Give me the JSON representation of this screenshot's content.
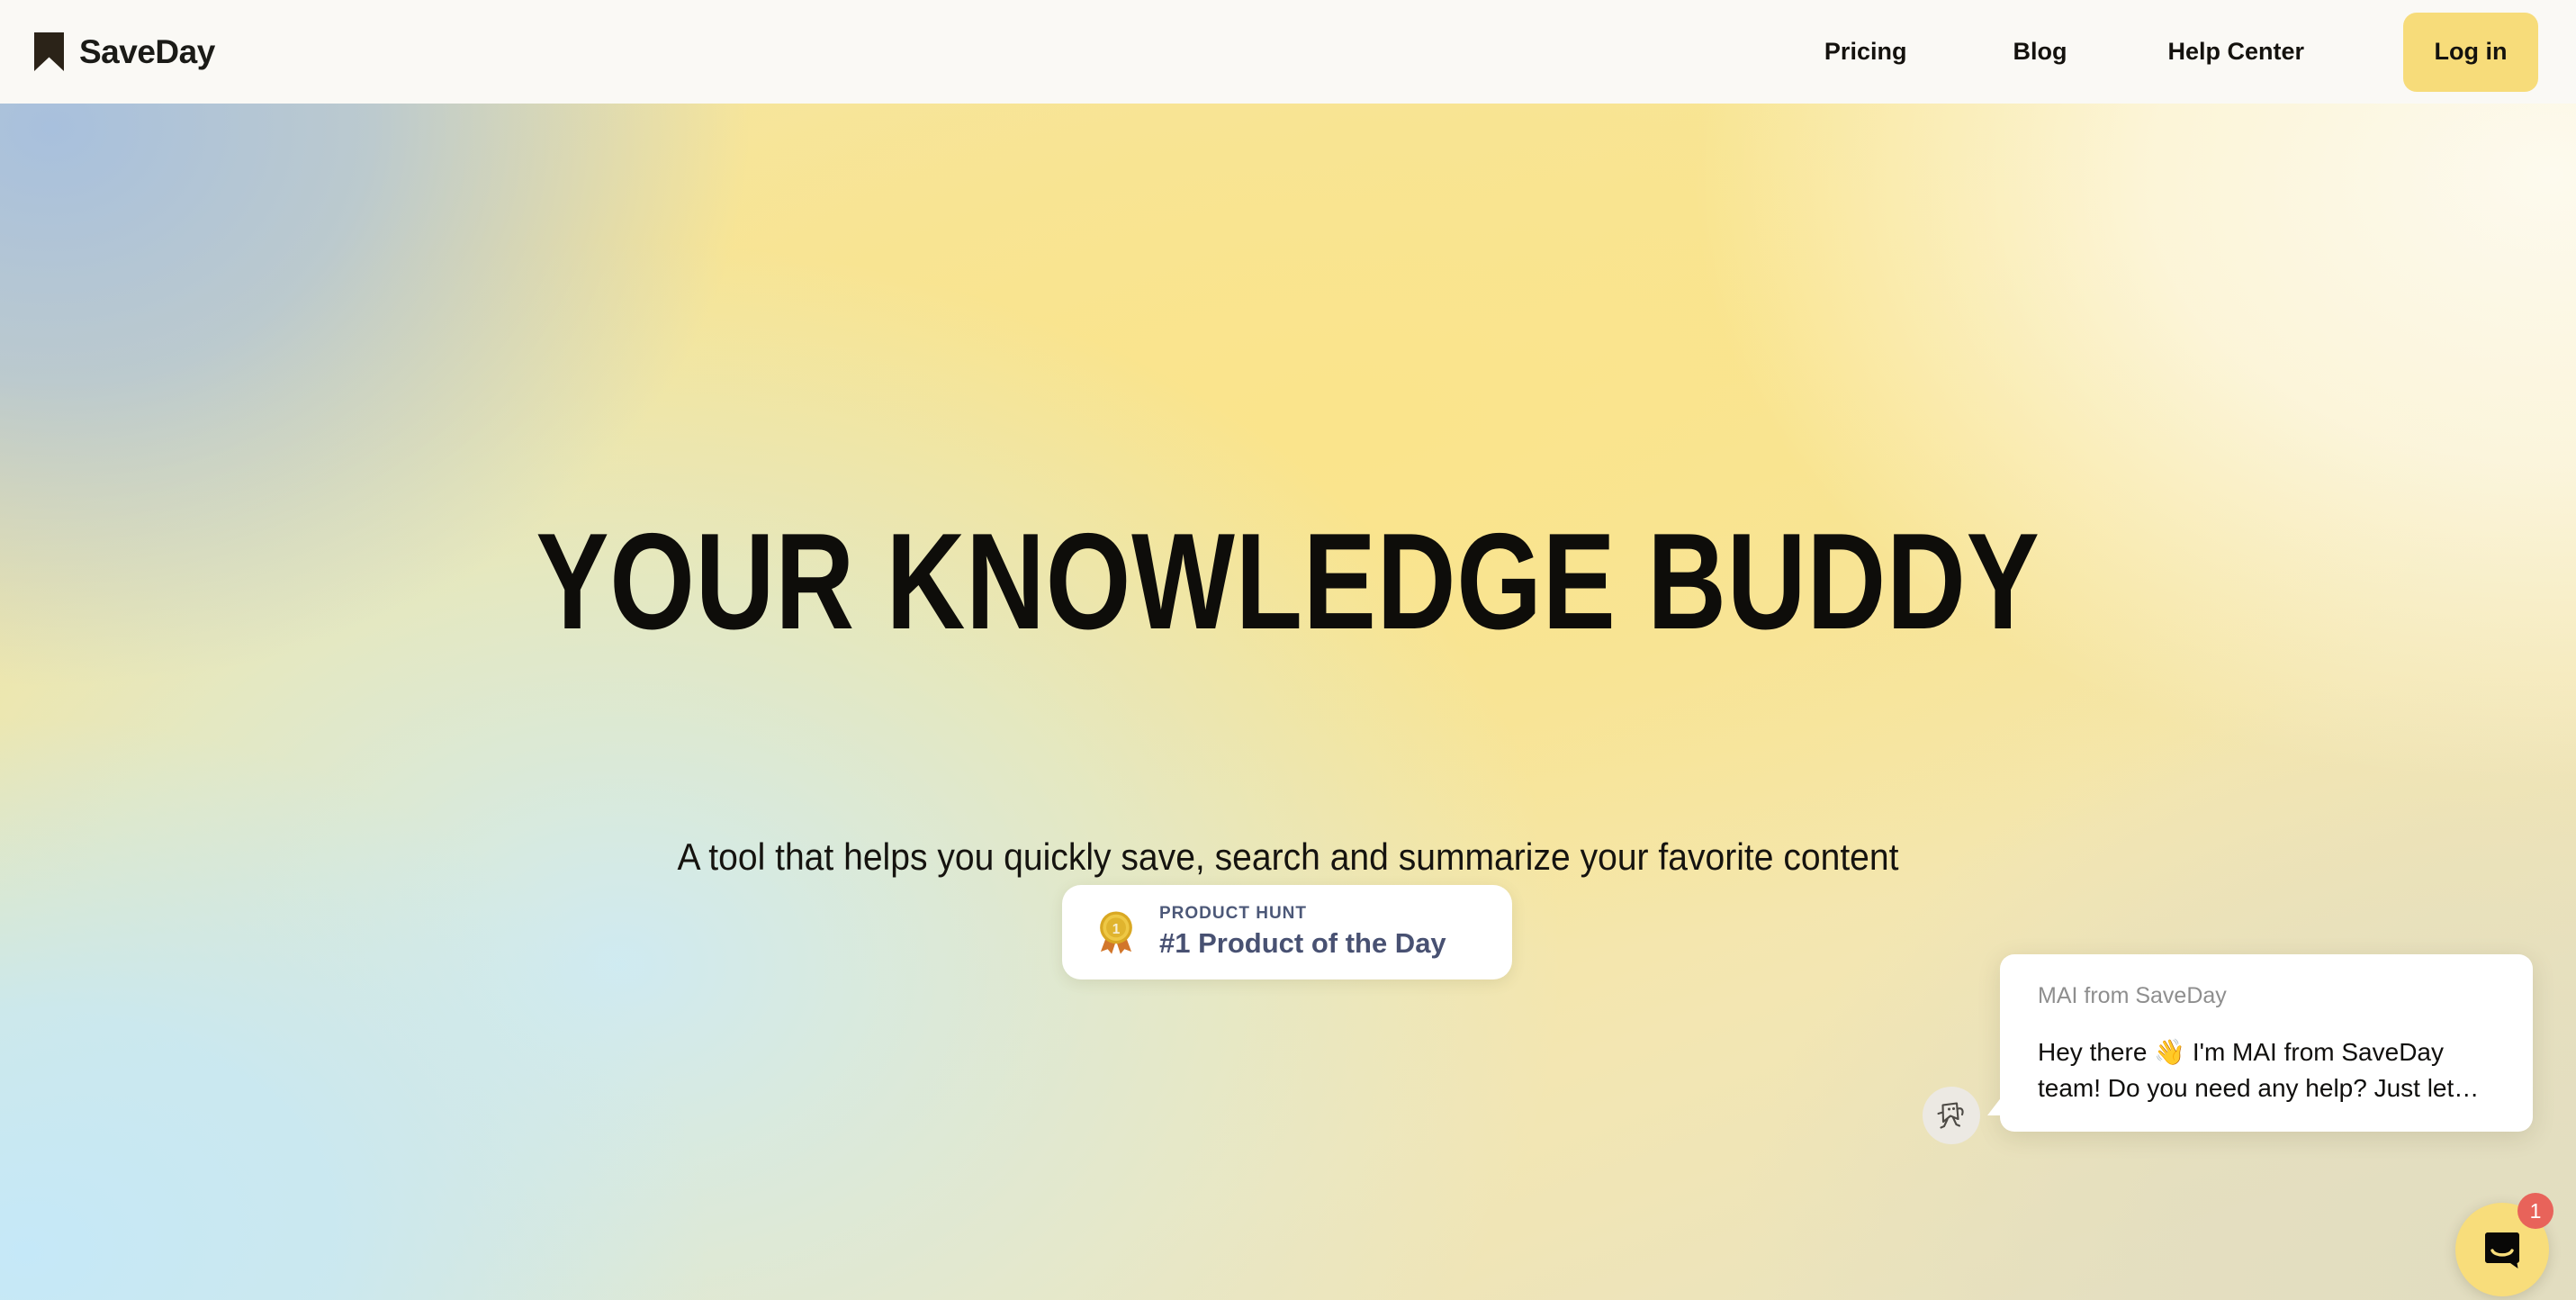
{
  "header": {
    "brand": {
      "name": "SaveDay",
      "logo_icon": "bookmark-icon",
      "logo_color": "#2b2318"
    },
    "nav": [
      {
        "label": "Pricing"
      },
      {
        "label": "Blog"
      },
      {
        "label": "Help Center"
      }
    ],
    "login_button": {
      "label": "Log in",
      "background": "#f7dc7a",
      "text_color": "#14120e"
    },
    "background": "#faf9f5"
  },
  "hero": {
    "title": "YOUR KNOWLEDGE BUDDY",
    "subtitle": "A tool that helps you quickly save, search and summarize your favorite content",
    "title_color": "#0e0d0a",
    "gradient_colors": {
      "top_left": "#a8c0dd",
      "top_right": "#fdfaee",
      "center": "#fae48c",
      "bottom_left": "#c5e8f8",
      "bottom_right": "#e2ddc0"
    }
  },
  "product_hunt_badge": {
    "medal_icon": "gold-medal-icon",
    "eyebrow": "PRODUCT HUNT",
    "headline": "#1 Product of the Day",
    "text_color": "#485172",
    "card_background": "#ffffff"
  },
  "chat_widget": {
    "avatar_icon": "dancing-square-avatar-icon",
    "sender": "MAI from SaveDay",
    "message": "Hey there 👋 I'm MAI from SaveDay team! Do you need any help? Just let…",
    "launcher_icon": "speech-bubble-icon",
    "launcher_background": "#f8dd7b",
    "unread_count": "1",
    "unread_badge_color": "#e8635a"
  }
}
